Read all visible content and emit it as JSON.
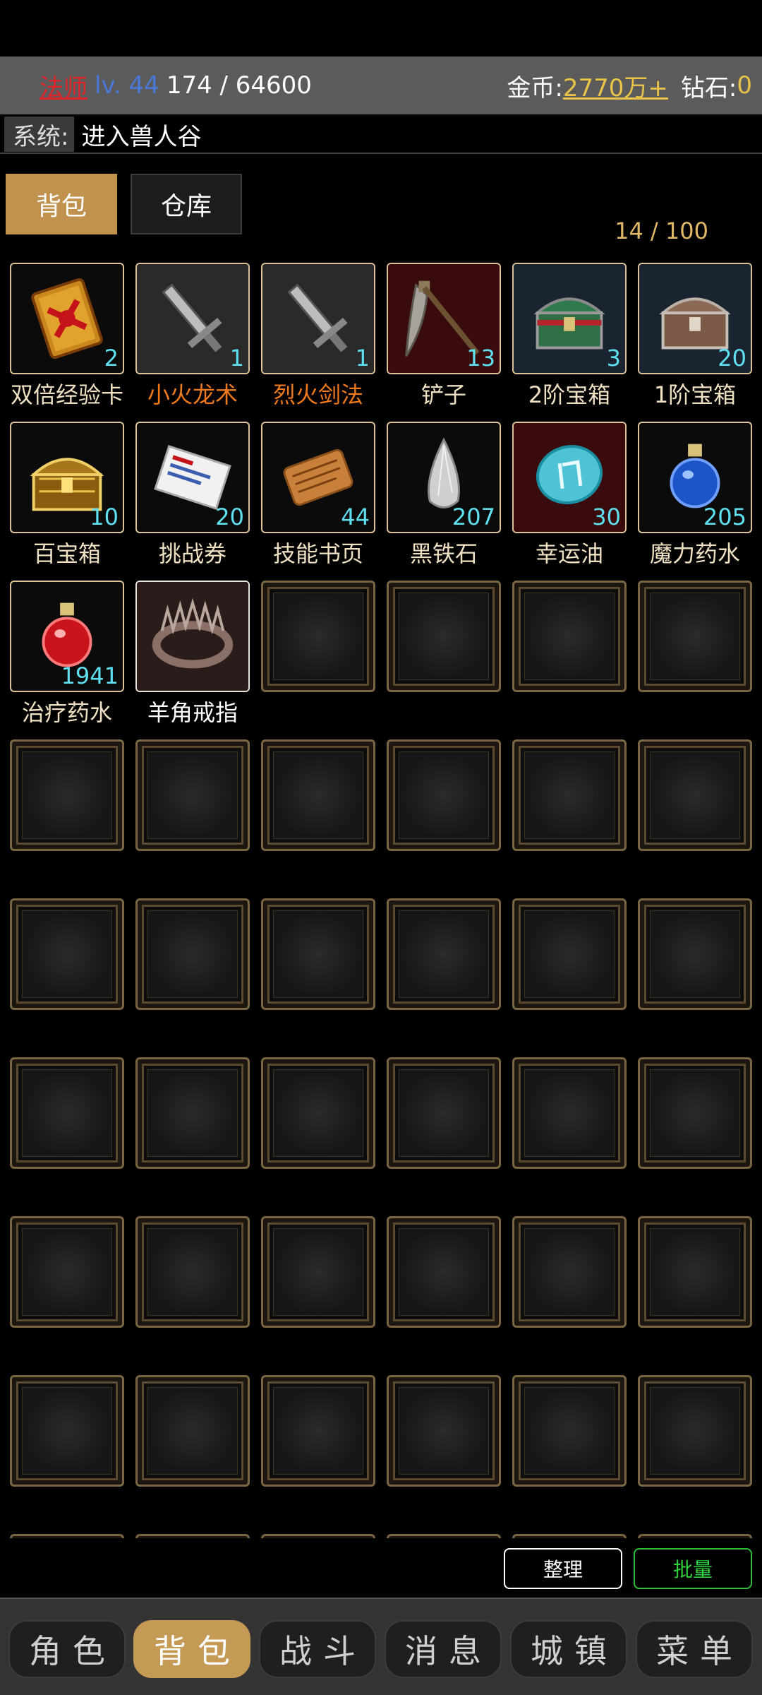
{
  "header": {
    "class_name": "法师",
    "level": "lv. 44",
    "exp": "174 / 64600",
    "gold_label": "金币:",
    "gold_value": "2770万+",
    "gem_label": "钻石:",
    "gem_value": "0"
  },
  "system": {
    "tag": "系统:",
    "message": "进入兽人谷"
  },
  "tabs": {
    "bag": "背包",
    "warehouse": "仓库"
  },
  "capacity": "14 / 100",
  "items": [
    {
      "name": "双倍经验卡",
      "qty": "2",
      "icon": "double-exp-card-icon",
      "name_color": "normal"
    },
    {
      "name": "小火龙术",
      "qty": "1",
      "icon": "skill-sword-icon",
      "name_color": "orange"
    },
    {
      "name": "烈火剑法",
      "qty": "1",
      "icon": "skill-sword-icon",
      "name_color": "orange"
    },
    {
      "name": "铲子",
      "qty": "13",
      "icon": "pickaxe-icon",
      "name_color": "normal"
    },
    {
      "name": "2阶宝箱",
      "qty": "3",
      "icon": "green-chest-icon",
      "name_color": "normal"
    },
    {
      "name": "1阶宝箱",
      "qty": "20",
      "icon": "brown-chest-icon",
      "name_color": "normal"
    },
    {
      "name": "百宝箱",
      "qty": "10",
      "icon": "gold-chest-icon",
      "name_color": "normal"
    },
    {
      "name": "挑战券",
      "qty": "20",
      "icon": "ticket-icon",
      "name_color": "normal"
    },
    {
      "name": "技能书页",
      "qty": "44",
      "icon": "scroll-icon",
      "name_color": "normal"
    },
    {
      "name": "黑铁石",
      "qty": "207",
      "icon": "crystal-icon",
      "name_color": "normal"
    },
    {
      "name": "幸运油",
      "qty": "30",
      "icon": "lucky-oil-icon",
      "name_color": "normal"
    },
    {
      "name": "魔力药水",
      "qty": "205",
      "icon": "blue-potion-icon",
      "name_color": "normal"
    },
    {
      "name": "治疗药水",
      "qty": "1941",
      "icon": "red-potion-icon",
      "name_color": "normal"
    },
    {
      "name": "羊角戒指",
      "qty": "",
      "icon": "horn-ring-icon",
      "name_color": "white"
    }
  ],
  "actions": {
    "arrange": "整理",
    "batch": "批量"
  },
  "nav": [
    "角色",
    "背包",
    "战斗",
    "消息",
    "城镇",
    "菜单"
  ],
  "nav_active": "背包",
  "colors": {
    "accent": "#c59a55",
    "qty": "#5fe0f0",
    "orange_name": "#ef7a1c",
    "gold": "#e8c34a"
  }
}
